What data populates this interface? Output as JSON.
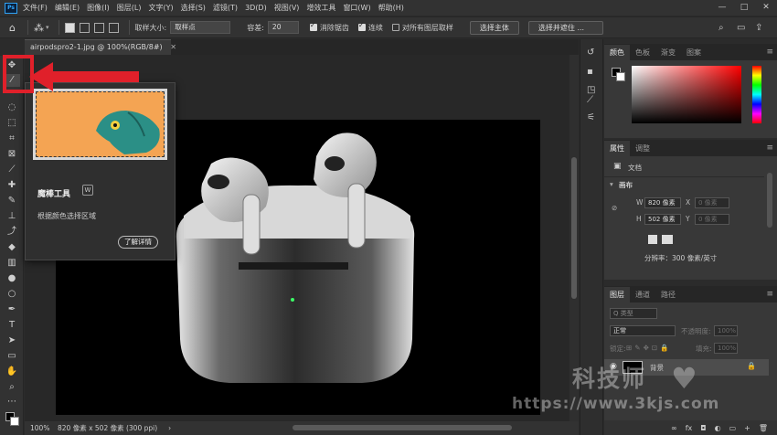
{
  "menubar": {
    "logo": "Ps",
    "items": [
      "文件(F)",
      "编辑(E)",
      "图像(I)",
      "图层(L)",
      "文字(Y)",
      "选择(S)",
      "滤镜(T)",
      "3D(D)",
      "视图(V)",
      "增效工具",
      "窗口(W)",
      "帮助(H)"
    ],
    "window_buttons": [
      "—",
      "□",
      "✕"
    ]
  },
  "options": {
    "sample_size_label": "取样大小:",
    "sample_size_value": "取样点",
    "tolerance_label": "容差:",
    "tolerance_value": "20",
    "antialias_label": "消除锯齿",
    "contiguous_label": "连续",
    "sample_all_label": "对所有图层取样",
    "select_subject_label": "选择主体",
    "select_mask_label": "选择并遮住 ..."
  },
  "tab": {
    "label": "airpodspro2-1.jpg @ 100%(RGB/8#)",
    "close": "✕"
  },
  "tooltip": {
    "title": "魔棒工具",
    "shortcut": "W",
    "description": "根据颜色选择区域",
    "learn_more": "了解详情"
  },
  "statusbar": {
    "zoom": "100%",
    "info": "820 像素 x 502 像素 (300 ppi)",
    "arrow": "›"
  },
  "color_panel": {
    "tabs": [
      "颜色",
      "色板",
      "渐变",
      "图案"
    ]
  },
  "props_panel": {
    "tabs": [
      "属性",
      "调整"
    ],
    "doc_label": "文档",
    "canvas_label": "画布",
    "w_label": "W",
    "w_value": "820 像素",
    "x_label": "X",
    "x_value": "0 像素",
    "h_label": "H",
    "h_value": "502 像素",
    "y_label": "Y",
    "y_value": "0 像素",
    "resolution": "分辨率：300 像素/英寸"
  },
  "layers_panel": {
    "tabs": [
      "图层",
      "通道",
      "路径"
    ],
    "search_placeholder": "Q 类型",
    "blend_mode": "正常",
    "opacity_label": "不透明度:",
    "opacity_value": "100%",
    "lock_label": "锁定:",
    "fill_label": "填充:",
    "fill_value": "100%",
    "layer_name": "背景",
    "bottom_icons": [
      "∞",
      "fx",
      "◘",
      "◐",
      "▭",
      "+",
      "🗑"
    ]
  },
  "watermark": {
    "brand": "科技师",
    "url": "https://www.3kjs.com"
  },
  "colors": {
    "accent": "#e0202a",
    "swatch_orange": "#f4a453"
  }
}
